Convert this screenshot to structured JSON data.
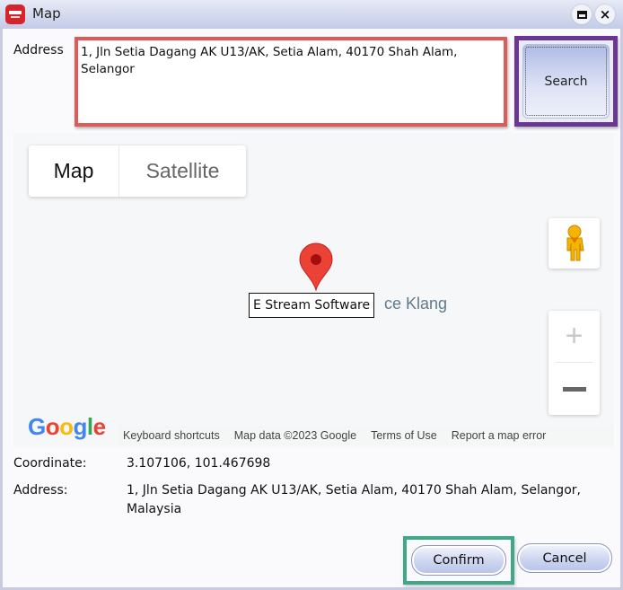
{
  "window": {
    "title": "Map",
    "maximize_icon": "maximize-icon",
    "close_icon": "×"
  },
  "search_form": {
    "address_label": "Address",
    "address_value": "1, Jln Setia Dagang AK U13/AK, Setia Alam, 40170 Shah Alam, Selangor",
    "search_label": "Search",
    "highlight_colors": {
      "address": "#e05a5a",
      "search": "#6a3593",
      "confirm": "#3fa886"
    }
  },
  "map": {
    "map_type_tabs": [
      {
        "label": "Map",
        "selected": true
      },
      {
        "label": "Satellite",
        "selected": false
      }
    ],
    "marker_label": "E Stream Software",
    "place_label": "ce Klang",
    "pegman_icon": "pegman-icon",
    "zoom_in": "+",
    "zoom_out": "−",
    "logo": [
      "G",
      "o",
      "o",
      "g",
      "l",
      "e"
    ],
    "logo_colors": [
      "#4285f4",
      "#ea4335",
      "#fbbc05",
      "#4285f4",
      "#34a853",
      "#ea4335"
    ],
    "attribution": {
      "keyboard_shortcuts": "Keyboard shortcuts",
      "map_data": "Map data ©2023 Google",
      "terms": "Terms of Use",
      "report": "Report a map error"
    },
    "marker_color": "#ea4335"
  },
  "result": {
    "coordinate_label": "Coordinate:",
    "coordinate_value": "3.107106, 101.467698",
    "address_label": "Address:",
    "address_value": "1, Jln Setia Dagang AK U13/AK, Setia Alam, 40170 Shah Alam, Selangor, Malaysia"
  },
  "actions": {
    "confirm_label": "Confirm",
    "cancel_label": "Cancel"
  }
}
